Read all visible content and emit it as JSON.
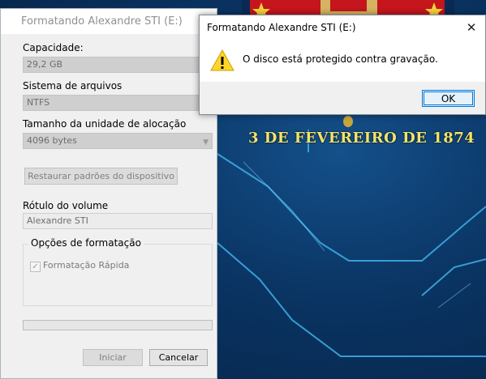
{
  "desktop": {
    "wallpaper_text": "3 DE FEVEREIRO DE 1874",
    "accent_gold": "#f1e46a",
    "circuit_color": "#3fb0e8"
  },
  "format_dialog": {
    "title": "Formatando Alexandre STI (E:)",
    "capacity": {
      "label": "Capacidade:",
      "value": "29,2 GB"
    },
    "filesystem": {
      "label": "Sistema de arquivos",
      "value": "NTFS"
    },
    "allocation": {
      "label": "Tamanho da unidade de alocação",
      "value": "4096 bytes",
      "icon": "chevron-down-icon"
    },
    "restore_button": "Restaurar padrões do dispositivo",
    "volume_label": {
      "label": "Rótulo do volume",
      "value": "Alexandre STI"
    },
    "format_options": {
      "legend": "Opções de formatação",
      "quick_format": {
        "label": "Formatação Rápida",
        "checked": true,
        "check_glyph": "✓"
      }
    },
    "progress": 0,
    "start_button": "Iniciar",
    "cancel_button": "Cancelar"
  },
  "message_box": {
    "title": "Formatando Alexandre STI (E:)",
    "close_glyph": "✕",
    "icon": "warning-icon",
    "message": "O disco está protegido contra gravação.",
    "ok_button": "OK"
  }
}
